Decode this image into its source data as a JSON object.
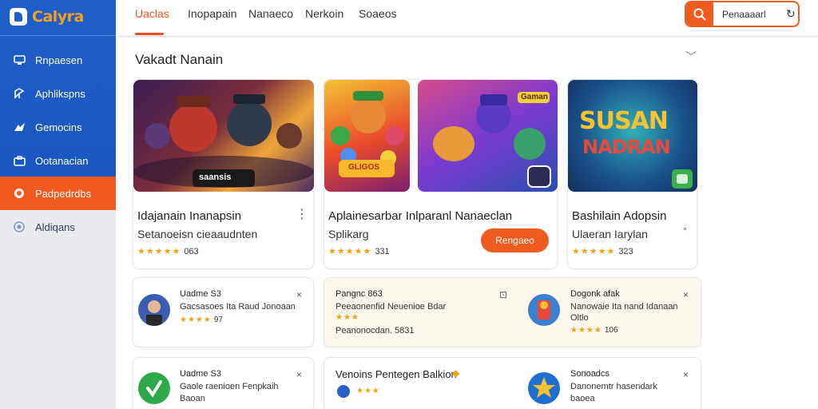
{
  "brand": {
    "name": "Calyra",
    "accent": "#ef5c20",
    "sidebar_color": "#1f5fc9"
  },
  "sidebar": {
    "items": [
      {
        "label": "Rnpaesen",
        "icon": "monitor-icon"
      },
      {
        "label": "Aphlikspns",
        "icon": "apps-icon"
      },
      {
        "label": "Gemocins",
        "icon": "gamepad-icon"
      },
      {
        "label": "Ootanacian",
        "icon": "briefcase-icon"
      },
      {
        "label": "Padpedrdbs",
        "icon": "record-icon",
        "active": true
      },
      {
        "label": "Aldiqans",
        "icon": "globe-icon"
      }
    ]
  },
  "topbar": {
    "tabs": [
      {
        "label": "Uaclas",
        "active": true
      },
      {
        "label": "Inopapain"
      },
      {
        "label": "Nanaeco"
      },
      {
        "label": "Nerkoin"
      },
      {
        "label": "Soaeos"
      }
    ],
    "search": {
      "value": "Penaaaarl"
    }
  },
  "section": {
    "title": "Vakadt Nanain"
  },
  "featured": [
    {
      "title": "Idajanain Inanapsin",
      "subtitle": "Setanoeisn cieaaudnten",
      "stars": "★★★★★",
      "rating": "063",
      "thumb_caption": "saansis"
    },
    {
      "title": "Aplainesarbar Inlparanl Nanaeclan",
      "subtitle": "Splikarg",
      "stars": "★★★★★",
      "rating": "331",
      "button": "Rengaeo",
      "thumb1_caption": "GLIGOS",
      "thumb2_caption": "Gaman"
    },
    {
      "title": "Bashilain Adopsin",
      "subtitle": "Ulaeran Iarylan",
      "stars": "★★★★★",
      "rating": "323",
      "thumb_line1": "SUSAN",
      "thumb_line2": "NADRAN"
    }
  ],
  "list": [
    {
      "name": "Uadme S3",
      "desc": "Gacsasoes Ita Raud Jonoaan",
      "stars": "★★★★",
      "rating": "97"
    },
    {
      "name": "Pangnc 863",
      "desc": "Peeaonenfid Neuenioe Bdar",
      "stars": "★★★",
      "desc2": "Peanonocdan. 5831"
    },
    {
      "name": "Dogonk afak",
      "desc": "Nanowaie Ita nand Idanaan",
      "desc2": "Oltlo",
      "stars": "★★★★",
      "rating": "106"
    },
    {
      "name": "Uadme S3",
      "desc": "Gaole raenioen Fenpkaih",
      "desc2": "Baoan"
    },
    {
      "title": "Venoins Pentegen Balkion",
      "stars": "★★★"
    },
    {
      "name": "Sonoadcs",
      "desc": "Danonemtr hasendark",
      "desc2": "baoea"
    }
  ]
}
